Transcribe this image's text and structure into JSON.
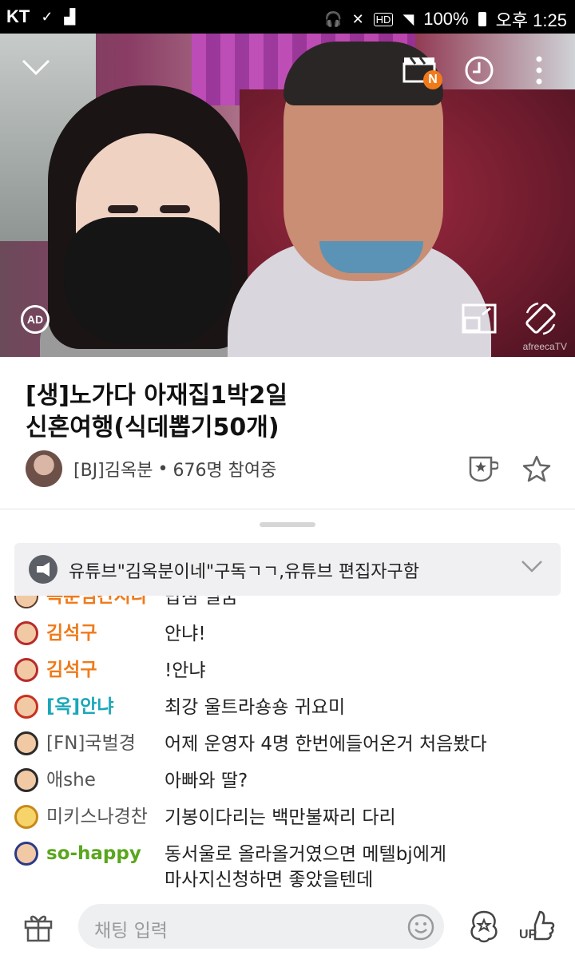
{
  "status": {
    "carrier": "KT",
    "battery": "100%",
    "time": "오후 1:25"
  },
  "player": {
    "ad_label": "AD",
    "watermark": "afreecaTV",
    "vod_badge": "N"
  },
  "broadcast": {
    "title_line1": "[생]노가다 아재집1박2일",
    "title_line2": "신혼여행(식데뽑기50개)",
    "bj_name": "[BJ]김옥분",
    "separator": "•",
    "viewers": "676명 참여중"
  },
  "notice": {
    "text": "유튜브\"김옥분이네\"구독ㄱㄱ,유튜브 편집자구함"
  },
  "chat": {
    "partial_nick": "옥분님간지나",
    "partial_msg": "맙점 필굼",
    "messages": [
      {
        "nick": "김석구",
        "text": "안냐!",
        "color": "#f07a1a"
      },
      {
        "nick": "김석구",
        "text": "!안냐",
        "color": "#f07a1a"
      },
      {
        "nick": "[옥]안냐",
        "text": "최강 울트라숑숑 귀요미",
        "color": "#1aa7b8"
      },
      {
        "nick": "[FN]국벌경",
        "text": "어제 운영자 4명 한번에들어온거 처음봤다",
        "color": "#555555"
      },
      {
        "nick": "애she",
        "text": "아빠와 딸?",
        "color": "#555555"
      },
      {
        "nick": "미키스나경찬",
        "text": "기봉이다리는 백만불짜리 다리",
        "color": "#555555"
      },
      {
        "nick": "so-happy",
        "text": "동서울로 올라올거였으면 메텔bj에게",
        "text2": "마사지신청하면 좋았을텐데",
        "color": "#5aa61e"
      }
    ]
  },
  "bottom": {
    "input_placeholder": "채팅 입력",
    "up_label": "UP"
  },
  "colors": {
    "accent_orange": "#f07a1a",
    "mod_teal": "#1aa7b8",
    "fan_green": "#5aa61e"
  }
}
